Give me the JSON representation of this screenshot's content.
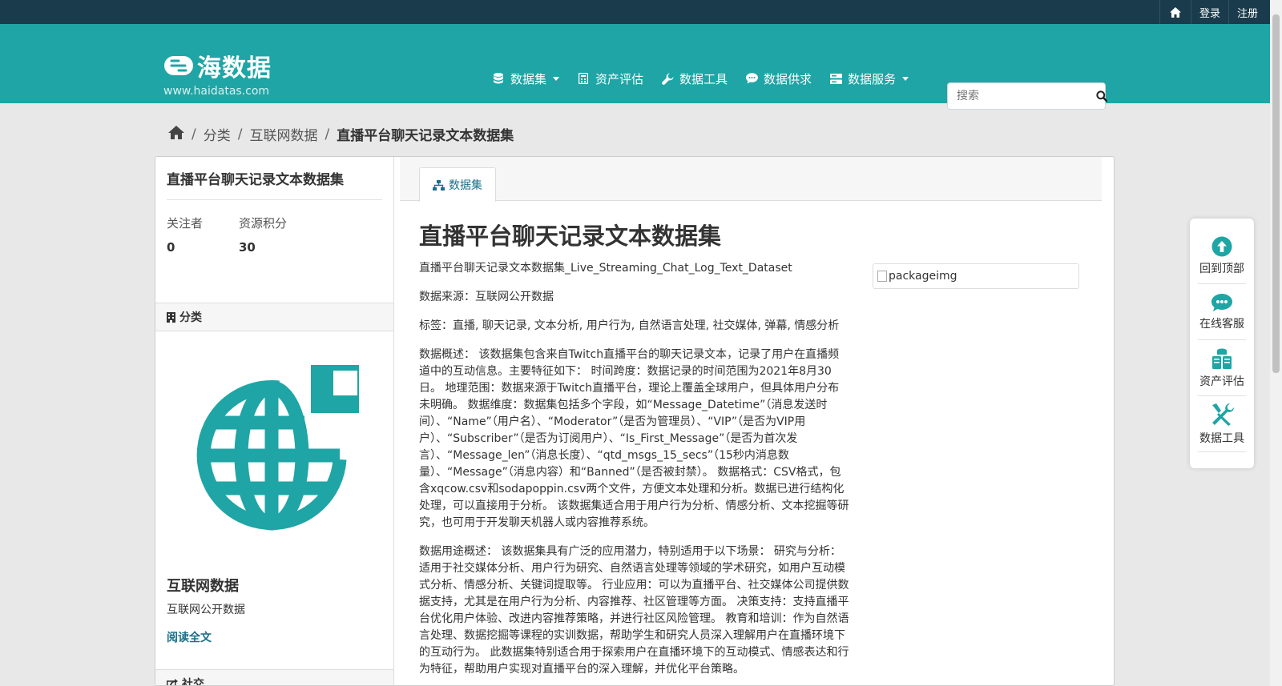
{
  "topbar": {
    "home_icon": "home-icon",
    "login": "登录",
    "register": "注册"
  },
  "header": {
    "logo_text": "海数据",
    "site_url": "www.haidatas.com",
    "nav": [
      {
        "label": "数据集",
        "icon": "database-icon",
        "dropdown": true
      },
      {
        "label": "资产评估",
        "icon": "calculator-icon",
        "dropdown": false
      },
      {
        "label": "数据工具",
        "icon": "wrench-icon",
        "dropdown": false
      },
      {
        "label": "数据供求",
        "icon": "comment-icon",
        "dropdown": false
      },
      {
        "label": "数据服务",
        "icon": "server-icon",
        "dropdown": true
      }
    ],
    "search_placeholder": "搜索"
  },
  "breadcrumb": {
    "items": [
      "分类",
      "互联网数据"
    ],
    "current": "直播平台聊天记录文本数据集"
  },
  "sidebar": {
    "title": "直播平台聊天记录文本数据集",
    "followers_label": "关注者",
    "followers_value": "0",
    "points_label": "资源积分",
    "points_value": "30",
    "category_heading": "分类",
    "category_name": "互联网数据",
    "category_desc": "互联网公开数据",
    "read_more": "阅读全文",
    "social_heading": "社交"
  },
  "content": {
    "tab_label": "数据集",
    "title": "直播平台聊天记录文本数据集",
    "paragraphs": [
      "直播平台聊天记录文本数据集_Live_Streaming_Chat_Log_Text_Dataset",
      "数据来源：互联网公开数据",
      "标签：直播, 聊天记录, 文本分析, 用户行为, 自然语言处理, 社交媒体, 弹幕, 情感分析",
      "数据概述： 该数据集包含来自Twitch直播平台的聊天记录文本，记录了用户在直播频道中的互动信息。主要特征如下： 时间跨度：数据记录的时间范围为2021年8月30日。 地理范围：数据来源于Twitch直播平台，理论上覆盖全球用户，但具体用户分布未明确。 数据维度：数据集包括多个字段，如“Message_Datetime”（消息发送时间）、“Name”（用户名）、“Moderator”（是否为管理员）、“VIP”（是否为VIP用户）、“Subscriber”（是否为订阅用户）、“Is_First_Message”（是否为首次发言）、“Message_len”（消息长度）、“qtd_msgs_15_secs”（15秒内消息数量）、“Message”（消息内容）和“Banned”（是否被封禁）。 数据格式：CSV格式，包含xqcow.csv和sodapoppin.csv两个文件，方便文本处理和分析。数据已进行结构化处理，可以直接用于分析。 该数据集适合用于用户行为分析、情感分析、文本挖掘等研究，也可用于开发聊天机器人或内容推荐系统。",
      "数据用途概述： 该数据集具有广泛的应用潜力，特别适用于以下场景： 研究与分析：适用于社交媒体分析、用户行为研究、自然语言处理等领域的学术研究，如用户互动模式分析、情感分析、关键词提取等。 行业应用：可以为直播平台、社交媒体公司提供数据支持，尤其是在用户行为分析、内容推荐、社区管理等方面。 决策支持：支持直播平台优化用户体验、改进内容推荐策略，并进行社区风险管理。 教育和培训：作为自然语言处理、数据挖掘等课程的实训数据，帮助学生和研究人员深入理解用户在直播环境下的互动行为。 此数据集特别适合用于探索用户在直播环境下的互动模式、情感表达和行为特征，帮助用户实现对直播平台的深入理解，并优化平台策略。"
    ],
    "image_alt": "packageimg"
  },
  "float_toolbar": [
    {
      "label": "回到顶部",
      "icon": "arrow-up-circle-icon"
    },
    {
      "label": "在线客服",
      "icon": "chat-bubble-icon"
    },
    {
      "label": "资产评估",
      "icon": "clipboard-icon"
    },
    {
      "label": "数据工具",
      "icon": "tools-icon"
    }
  ],
  "colors": {
    "brand": "#1fa5a5",
    "topbar": "#1a3b4b",
    "link": "#1a6f8a"
  }
}
